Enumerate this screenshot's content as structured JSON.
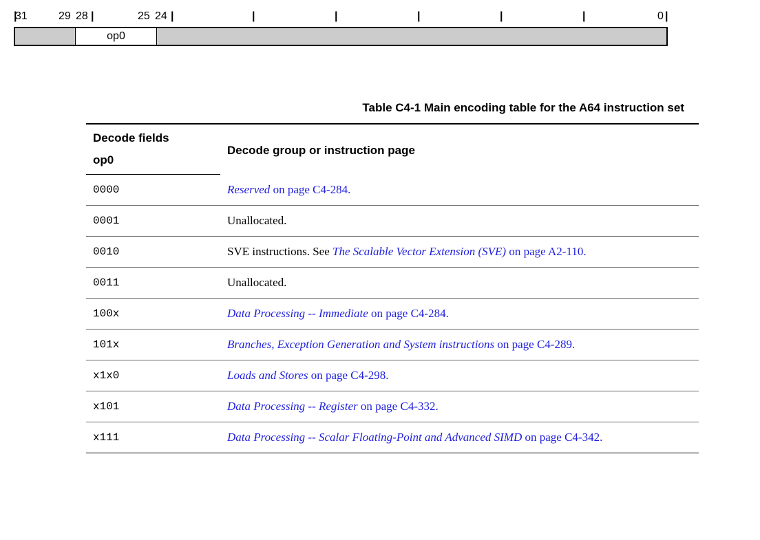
{
  "bitlabels": {
    "b31": "31",
    "b29": "29",
    "b28": "28",
    "b25": "25",
    "b24": "24",
    "b0": "0"
  },
  "bitfield": {
    "seg1_label": "",
    "seg2_label": "op0",
    "seg3_label": ""
  },
  "ticks": [
    "|",
    "|",
    "|",
    "|",
    "|",
    "|",
    "|",
    "|",
    "|"
  ],
  "caption": "Table C4-1 Main encoding table for the A64 instruction set",
  "headers": {
    "decode_fields": "Decode fields",
    "op0": "op0",
    "group": "Decode group or instruction page"
  },
  "rows": [
    {
      "op0": "0000",
      "link": "Reserved",
      "after_link": " on page C4-284.",
      "prefix": "",
      "is_link": true
    },
    {
      "op0": "0001",
      "plain": "Unallocated.",
      "is_link": false
    },
    {
      "op0": "0010",
      "prefix": "SVE instructions. See ",
      "link": "The Scalable Vector Extension (SVE)",
      "after_link": " on page A2-110.",
      "is_link": true
    },
    {
      "op0": "0011",
      "plain": "Unallocated.",
      "is_link": false
    },
    {
      "op0": "100x",
      "link": "Data Processing -- Immediate",
      "after_link": " on page C4-284.",
      "prefix": "",
      "is_link": true
    },
    {
      "op0": "101x",
      "link": "Branches, Exception Generation and System instructions",
      "after_link": " on page C4-289.",
      "prefix": "",
      "is_link": true
    },
    {
      "op0": "x1x0",
      "link": "Loads and Stores",
      "after_link": " on page C4-298.",
      "prefix": "",
      "is_link": true
    },
    {
      "op0": "x101",
      "link": "Data Processing -- Register",
      "after_link": " on page C4-332.",
      "prefix": "",
      "is_link": true
    },
    {
      "op0": "x111",
      "link": "Data Processing -- Scalar Floating-Point and Advanced SIMD",
      "after_link": " on page C4-342.",
      "prefix": "",
      "is_link": true
    }
  ]
}
